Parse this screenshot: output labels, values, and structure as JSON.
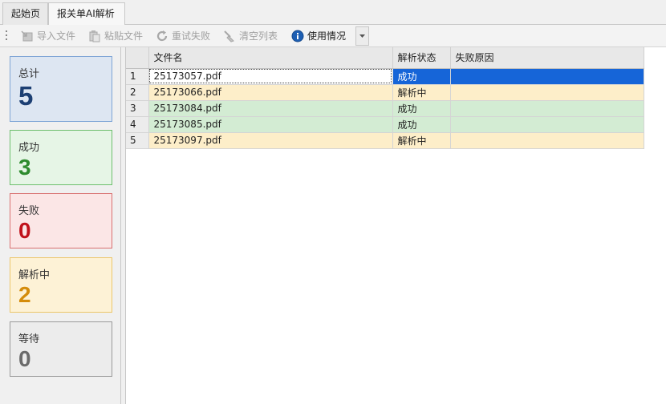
{
  "tabs": [
    {
      "label": "起始页"
    },
    {
      "label": "报关单AI解析"
    }
  ],
  "toolbar": {
    "import_label": "导入文件",
    "paste_label": "粘贴文件",
    "retry_label": "重试失败",
    "clear_label": "清空列表",
    "usage_label": "使用情况",
    "accent": "#1665d8"
  },
  "stats": {
    "total": {
      "label": "总计",
      "value": "5"
    },
    "success": {
      "label": "成功",
      "value": "3"
    },
    "fail": {
      "label": "失败",
      "value": "0"
    },
    "parsing": {
      "label": "解析中",
      "value": "2"
    },
    "waiting": {
      "label": "等待",
      "value": "0"
    }
  },
  "grid": {
    "columns": [
      "文件名",
      "解析状态",
      "失败原因"
    ],
    "rows": [
      {
        "index": "1",
        "file": "25173057.pdf",
        "status": "成功",
        "reason": ""
      },
      {
        "index": "2",
        "file": "25173066.pdf",
        "status": "解析中",
        "reason": ""
      },
      {
        "index": "3",
        "file": "25173084.pdf",
        "status": "成功",
        "reason": ""
      },
      {
        "index": "4",
        "file": "25173085.pdf",
        "status": "成功",
        "reason": ""
      },
      {
        "index": "5",
        "file": "25173097.pdf",
        "status": "解析中",
        "reason": ""
      }
    ]
  }
}
